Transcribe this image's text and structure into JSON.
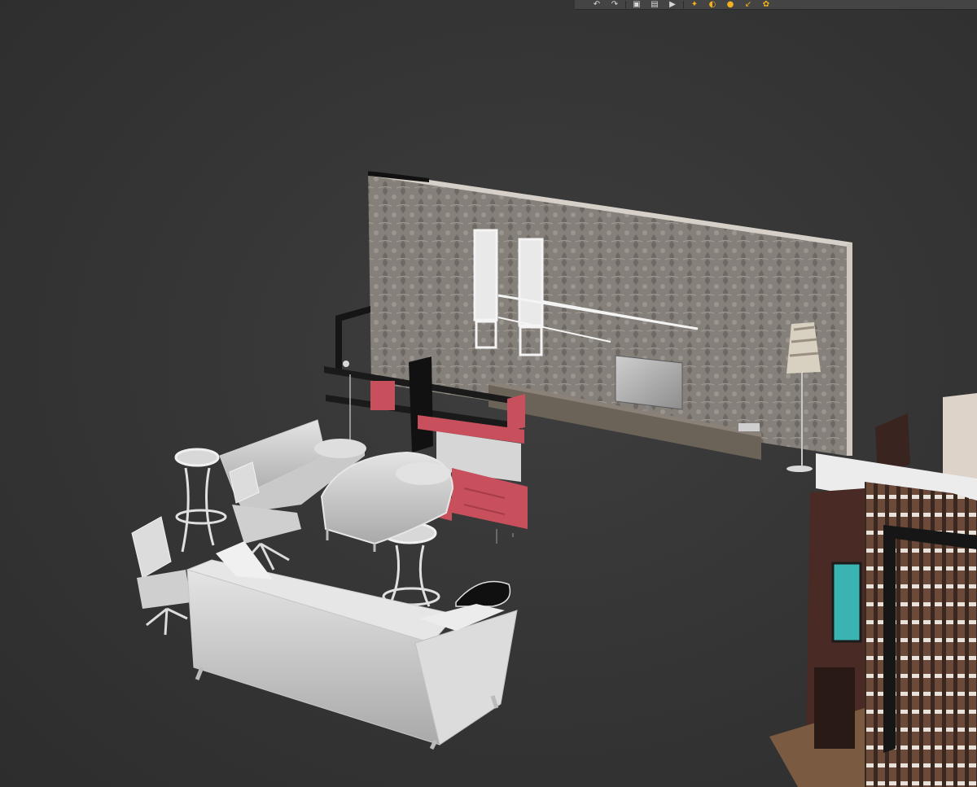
{
  "toolbar": {
    "icons": [
      {
        "name": "undo-icon",
        "glyph": "↶"
      },
      {
        "name": "redo-icon",
        "glyph": "↷"
      },
      {
        "name": "save-icon",
        "glyph": "▣"
      },
      {
        "name": "layers-icon",
        "glyph": "▤"
      },
      {
        "name": "camera-icon",
        "glyph": "▶"
      },
      {
        "name": "pin-icon",
        "glyph": "✦"
      },
      {
        "name": "render-icon",
        "glyph": "◐"
      },
      {
        "name": "light-icon",
        "glyph": "●"
      },
      {
        "name": "arrow-icon",
        "glyph": "↙"
      },
      {
        "name": "settings-icon",
        "glyph": "✿"
      }
    ],
    "accent": "#f2b01e"
  },
  "viewport": {
    "background": "#363636",
    "wallpaper_color": "#8a8178",
    "cabinet_accent": "#c8505c",
    "furniture_color": "#d9d9d9",
    "tv_screen": "#3bb3b3"
  }
}
